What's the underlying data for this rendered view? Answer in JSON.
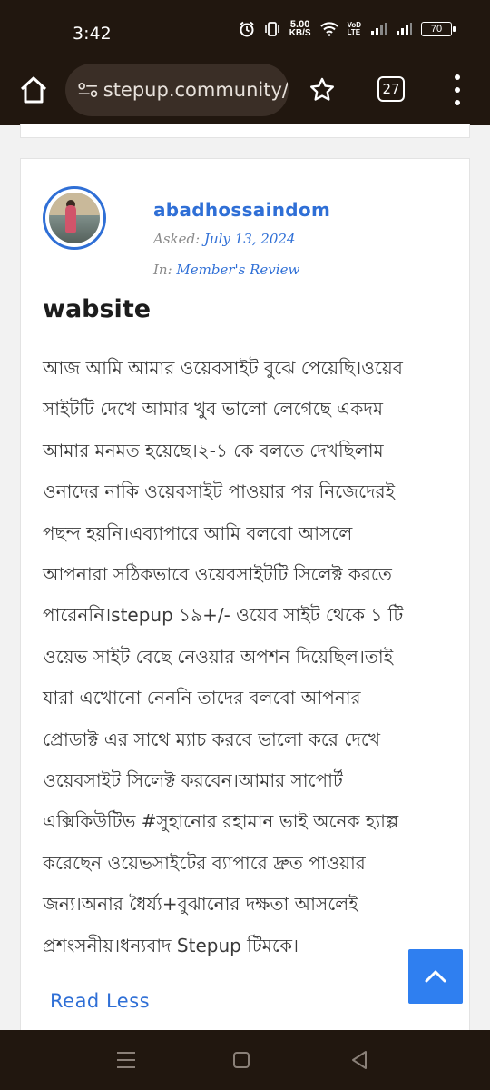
{
  "status_bar": {
    "time": "3:42",
    "speed_value": "5.00",
    "speed_unit": "KB/S",
    "volte_top": "VoD",
    "volte_bottom": "LTE",
    "battery": "70",
    "icons": [
      "alarm-icon",
      "vibrate-icon",
      "wifi-icon",
      "signal-icon",
      "signal-icon",
      "battery-icon"
    ]
  },
  "browser": {
    "url": "stepup.community/",
    "tab_count": "27",
    "icons": [
      "home-icon",
      "tune-icon",
      "star-icon",
      "tabs-icon",
      "more-vert-icon"
    ]
  },
  "question": {
    "author": "abadhossaindom",
    "asked_label": "Asked:",
    "asked_date": "July 13, 2024",
    "in_label": "In:",
    "category": "Member's Review",
    "title": "wabsite",
    "body_lines": [
      "আজ আমি আমার ওয়েবসাইট বুঝে পেয়েছি।ওয়েব",
      "সাইটটি দেখে আমার খুব ভালো লেগেছে একদম",
      "আমার মনমত হয়েছে।২-১ কে বলতে দেখছিলাম",
      "ওনাদের নাকি ওয়েবসাইট পাওয়ার পর নিজেদেরই",
      "পছন্দ হয়নি।এব্যাপারে আমি বলবো আসলে",
      "আপনারা সঠিকভাবে ওয়েবসাইটটি সিলেক্ট করতে",
      "পারেননি।stepup ১৯+/- ওয়েব সাইট থেকে ১ টি",
      "ওয়েভ সাইট বেছে নেওয়ার অপশন দিয়েছিল।তাই",
      "যারা এখোনো নেননি তাদের বলবো আপনার",
      "প্রোডাক্ট এর সাথে ম্যাচ করবে ভালো করে দেখে",
      "ওয়েবসাইট সিলেক্ট করবেন।আমার সাপোর্ট",
      "এক্সিকিউটিভ #সুহানোর রহামান ভাই অনেক হ্যাল্প",
      "করেছেন ওয়েভসাইটের ব্যাপারে দ্রুত পাওয়ার",
      "জন্য।অনার ধৈর্য্য+বুঝানোর দক্ষতা আসলেই",
      "প্রশংসনীয়।ধন্যবাদ Stepup টিমকে।"
    ],
    "read_less": "Read Less"
  },
  "colors": {
    "accent": "#2f6fd6",
    "scroll_button": "#2f7ff0",
    "system_bar": "#21170f"
  }
}
